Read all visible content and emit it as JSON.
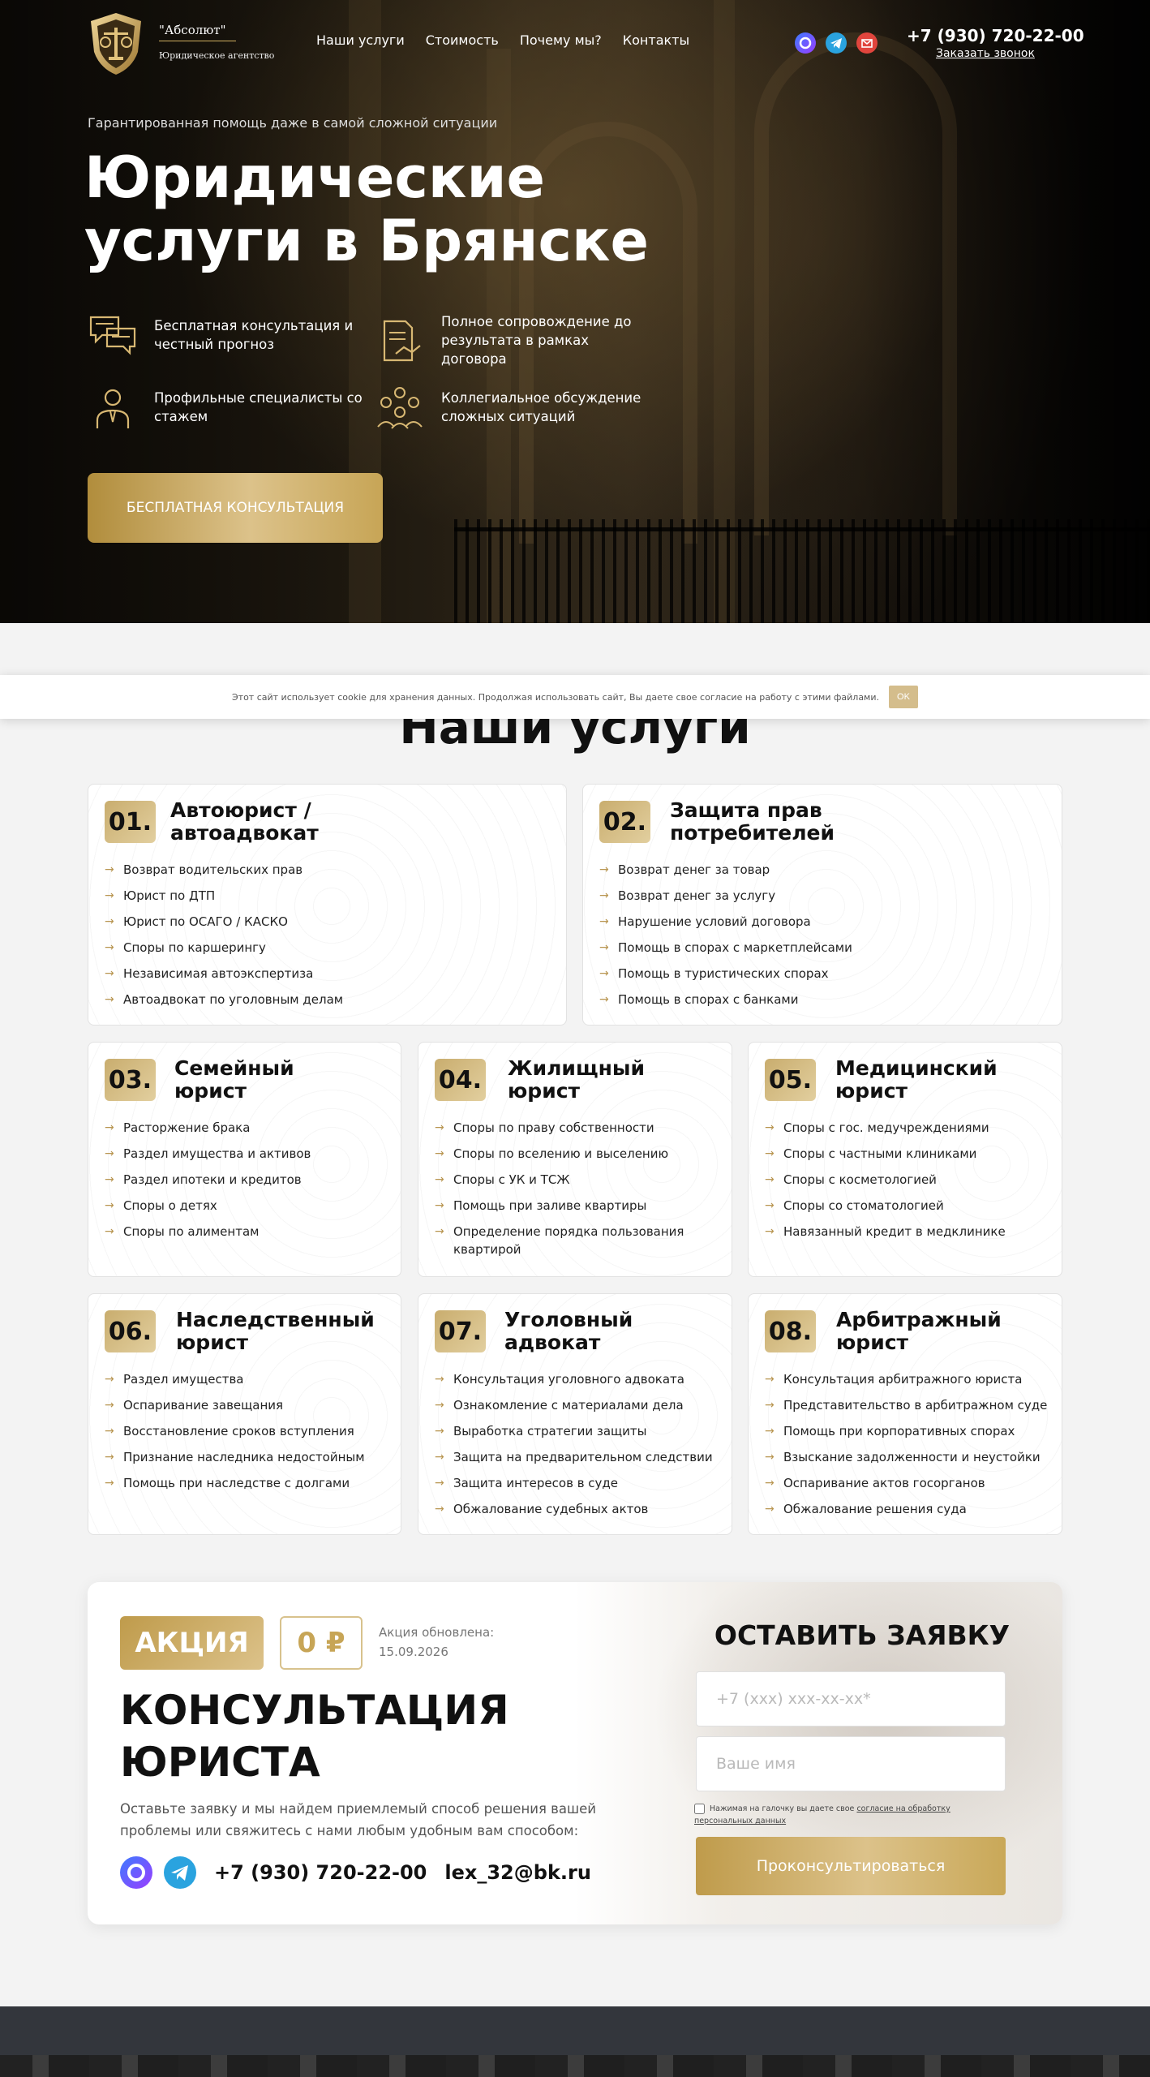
{
  "header": {
    "logo_line1": "\"Абсолют\"",
    "logo_line2": "Юридическое агентство",
    "nav": [
      "Наши услуги",
      "Стоимость",
      "Почему мы?",
      "Контакты"
    ],
    "phone": "+7 (930) 720-22-00",
    "callback": "Заказать звонок",
    "social_icons": [
      "max-icon",
      "telegram-icon",
      "email-icon"
    ]
  },
  "hero": {
    "tagline": "Гарантированная помощь даже в самой сложной ситуации",
    "title": "Юридические услуги в Брянске",
    "features": [
      {
        "icon": "chat-icon",
        "text": "Бесплатная консультация и честный прогноз"
      },
      {
        "icon": "contract-icon",
        "text": "Полное сопровождение до результата в рамках договора"
      },
      {
        "icon": "lawyer-icon",
        "text": "Профильные специалисты со стажем"
      },
      {
        "icon": "team-icon",
        "text": "Коллегиальное обсуждение сложных ситуаций"
      }
    ],
    "cta": "БЕСПЛАТНАЯ КОНСУЛЬТАЦИЯ"
  },
  "cookie": {
    "text": "Этот сайт использует cookie для хранения данных. Продолжая использовать сайт, Вы даете свое согласие на работу с этими файлами.",
    "ok": "OK"
  },
  "services": {
    "title": "Наши услуги",
    "cards": [
      {
        "num": "01.",
        "title": "Автоюрист / автоадвокат",
        "items": [
          "Возврат водительских прав",
          "Юрист по ДТП",
          "Юрист по ОСАГО / КАСКО",
          "Споры по каршерингу",
          "Независимая автоэкспертиза",
          "Автоадвокат по уголовным делам"
        ]
      },
      {
        "num": "02.",
        "title": "Защита прав потребителей",
        "items": [
          "Возврат денег за товар",
          "Возврат денег за услугу",
          "Нарушение условий договора",
          "Помощь в спорах с маркетплейсами",
          "Помощь в туристических спорах",
          "Помощь в спорах с банками"
        ]
      },
      {
        "num": "03.",
        "title": "Семейный юрист",
        "items": [
          "Расторжение брака",
          "Раздел имущества и активов",
          "Раздел ипотеки и кредитов",
          "Споры о детях",
          "Споры по алиментам"
        ]
      },
      {
        "num": "04.",
        "title": "Жилищный юрист",
        "items": [
          "Споры по праву собственности",
          "Споры по вселению и выселению",
          "Споры с УК и ТСЖ",
          "Помощь при заливе квартиры",
          "Определение порядка пользования квартирой"
        ]
      },
      {
        "num": "05.",
        "title": "Медицинский юрист",
        "items": [
          "Споры с гос. медучреждениями",
          "Споры с частными клиниками",
          "Споры с косметологией",
          "Споры со стоматологией",
          "Навязанный кредит в медклинике"
        ]
      },
      {
        "num": "06.",
        "title": "Наследственный юрист",
        "items": [
          "Раздел имущества",
          "Оспаривание завещания",
          "Восстановление сроков вступления",
          "Признание наследника недостойным",
          "Помощь при наследстве с долгами"
        ]
      },
      {
        "num": "07.",
        "title": "Уголовный адвокат",
        "items": [
          "Консультация уголовного адвоката",
          "Ознакомление с материалами дела",
          "Выработка стратегии защиты",
          "Защита на предварительном следствии",
          "Защита интересов в суде",
          "Обжалование судебных актов"
        ]
      },
      {
        "num": "08.",
        "title": "Арбитражный юрист",
        "items": [
          "Консультация арбитражного юриста",
          "Представительство в арбитражном суде",
          "Помощь при корпоративных спорах",
          "Взыскание задолженности и неустойки",
          "Оспаривание актов госорганов",
          "Обжалование решения суда"
        ]
      }
    ]
  },
  "promo": {
    "badge": "АКЦИЯ",
    "price": "0 ₽",
    "updated_label": "Акция обновлена:",
    "updated_date": "15.09.2026",
    "title_line1": "КОНСУЛЬТАЦИЯ",
    "title_line2": "ЮРИСТА",
    "description": "Оставьте заявку и мы найдем приемлемый способ решения вашей проблемы или свяжитесь с нами любым удобным вам способом:",
    "phone": "+7 (930) 720-22-00",
    "email": "lex_32@bk.ru"
  },
  "form": {
    "title": "ОСТАВИТЬ ЗАЯВКУ",
    "phone_placeholder": "+7 (xxx) xxx-xx-xx*",
    "name_placeholder": "Ваше имя",
    "agree_text": "Нажимая на галочку вы даете свое",
    "agree_link": "согласие на обработку персональных данных",
    "submit": "Проконсультироваться"
  },
  "colors": {
    "gold": "#c9a858",
    "dark": "#111111"
  }
}
